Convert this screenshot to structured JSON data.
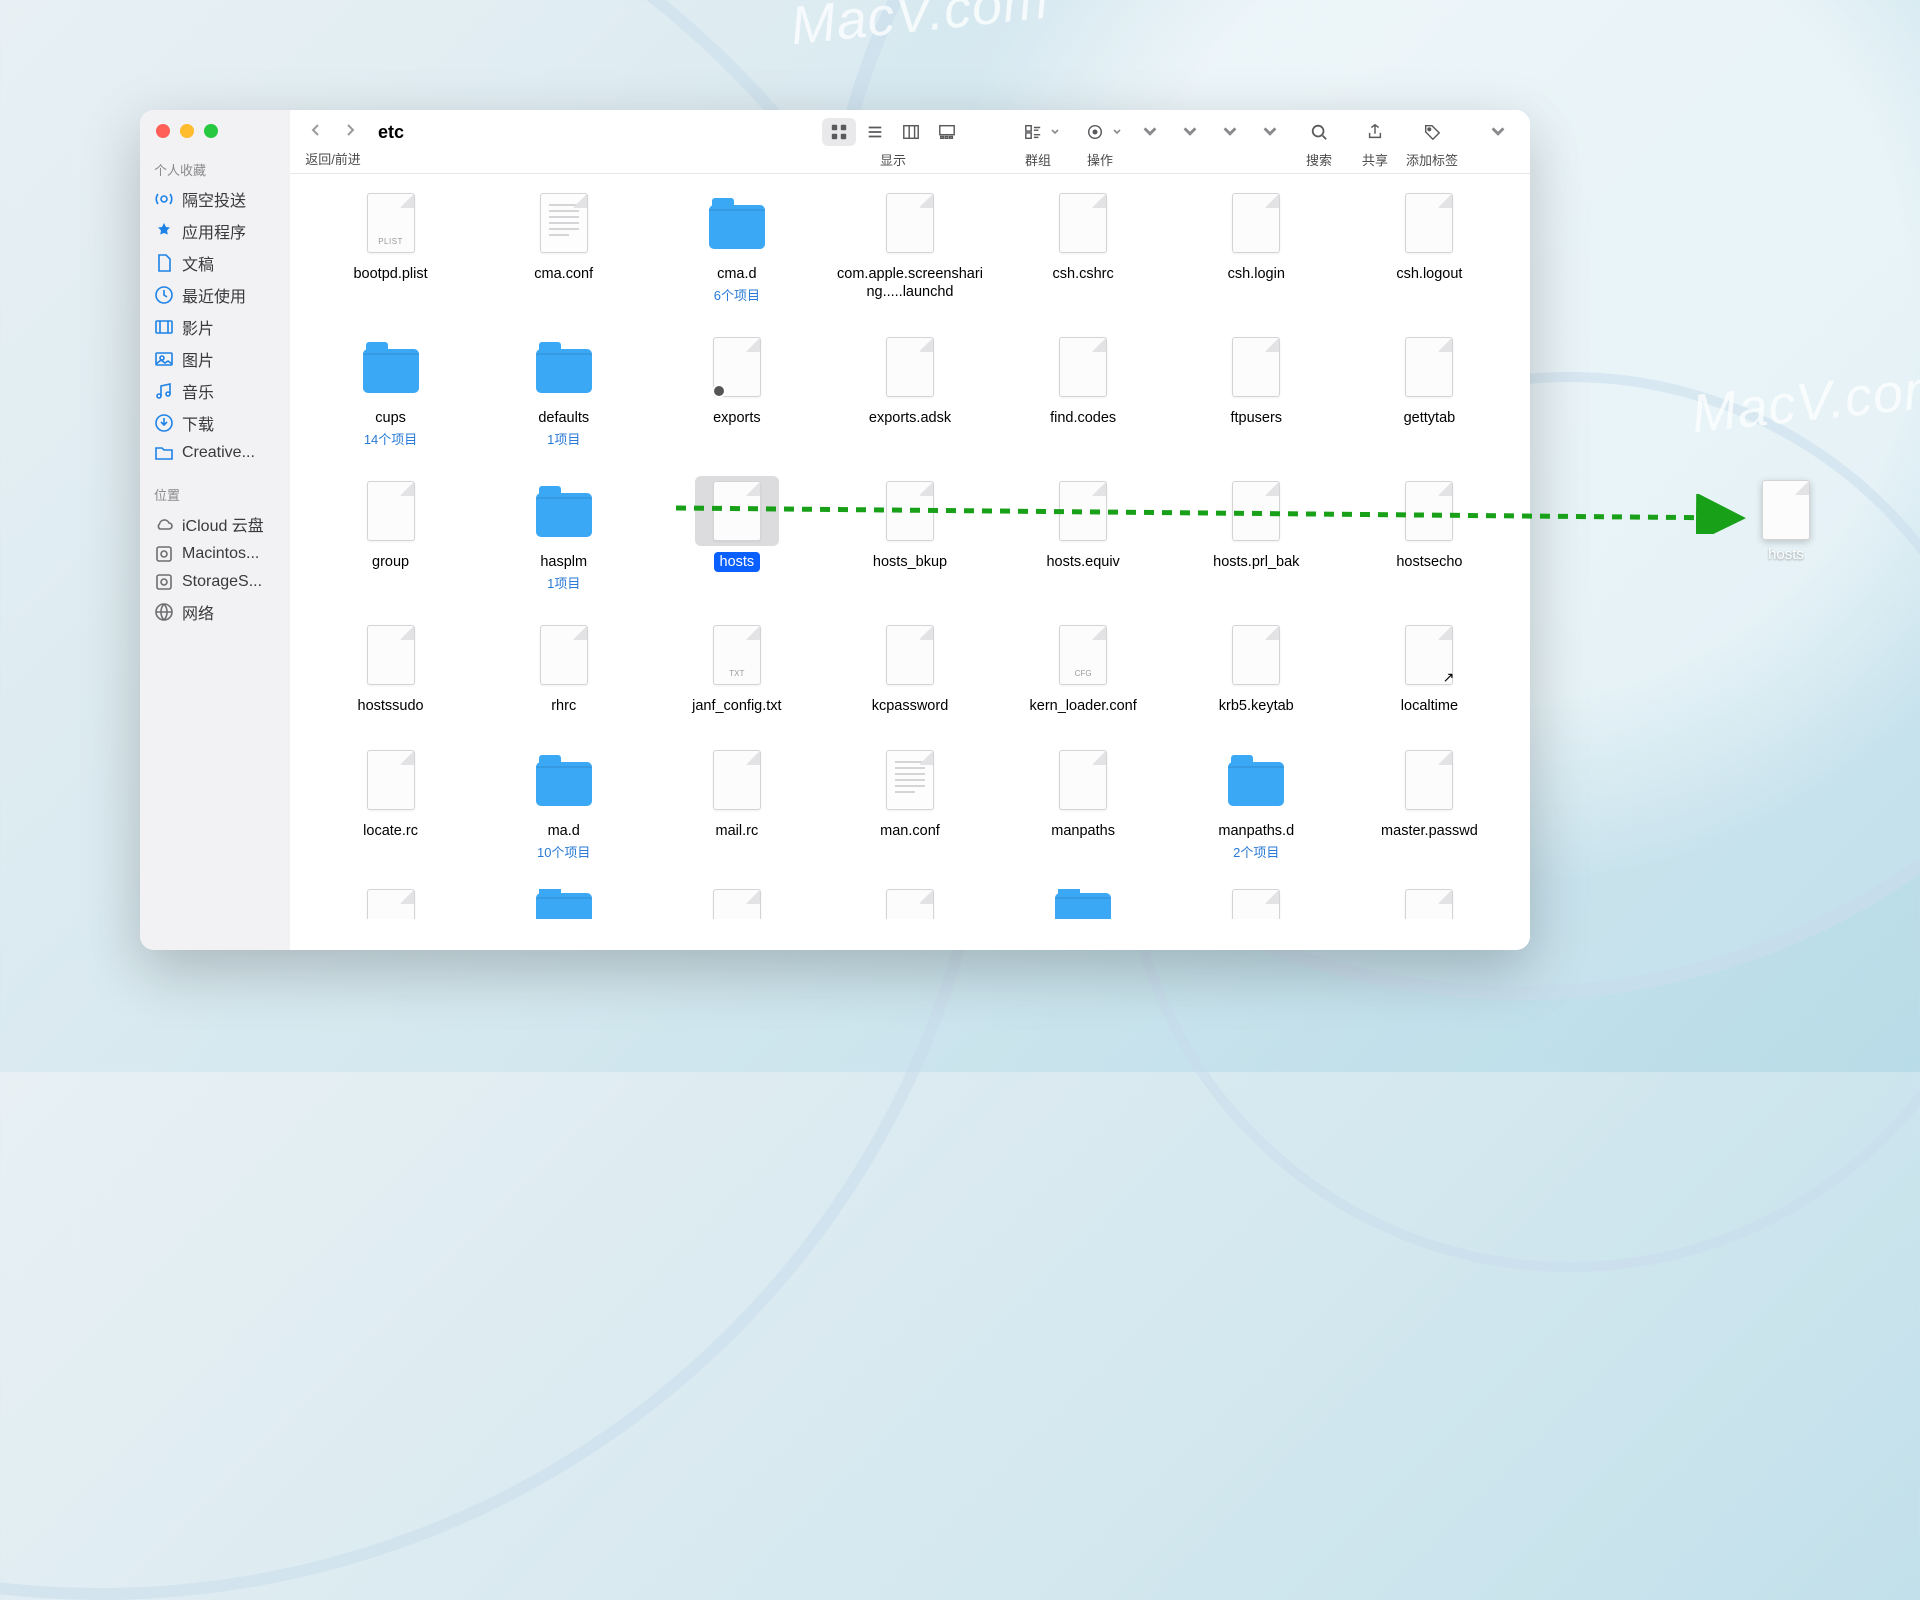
{
  "watermarks": {
    "text": "MacV.com"
  },
  "window": {
    "title": "etc",
    "nav_label": "返回/前进",
    "toolbar": {
      "view_label": "显示",
      "group_label": "群组",
      "action_label": "操作",
      "search_label": "搜索",
      "share_label": "共享",
      "tags_label": "添加标签"
    }
  },
  "sidebar": {
    "favorites_title": "个人收藏",
    "favorites": [
      {
        "icon": "airdrop",
        "label": "隔空投送"
      },
      {
        "icon": "apps",
        "label": "应用程序"
      },
      {
        "icon": "doc",
        "label": "文稿"
      },
      {
        "icon": "clock",
        "label": "最近使用"
      },
      {
        "icon": "movie",
        "label": "影片"
      },
      {
        "icon": "photo",
        "label": "图片"
      },
      {
        "icon": "music",
        "label": "音乐"
      },
      {
        "icon": "download",
        "label": "下载"
      },
      {
        "icon": "folder",
        "label": "Creative..."
      }
    ],
    "locations_title": "位置",
    "locations": [
      {
        "icon": "cloud",
        "label": "iCloud 云盘"
      },
      {
        "icon": "disk",
        "label": "Macintos..."
      },
      {
        "icon": "disk",
        "label": "StorageS..."
      },
      {
        "icon": "globe",
        "label": "网络"
      }
    ]
  },
  "files": [
    {
      "name": "bootpd.plist",
      "type": "plist"
    },
    {
      "name": "cma.conf",
      "type": "lines"
    },
    {
      "name": "cma.d",
      "type": "folder",
      "sub": "6个项目"
    },
    {
      "name": "com.apple.screensharing.....launchd",
      "type": "doc"
    },
    {
      "name": "csh.cshrc",
      "type": "doc"
    },
    {
      "name": "csh.login",
      "type": "doc"
    },
    {
      "name": "csh.logout",
      "type": "doc"
    },
    {
      "name": "cups",
      "type": "folder",
      "sub": "14个项目"
    },
    {
      "name": "defaults",
      "type": "folder",
      "sub": "1项目"
    },
    {
      "name": "exports",
      "type": "doc",
      "lock": true
    },
    {
      "name": "exports.adsk",
      "type": "doc"
    },
    {
      "name": "find.codes",
      "type": "doc"
    },
    {
      "name": "ftpusers",
      "type": "doc"
    },
    {
      "name": "gettytab",
      "type": "doc"
    },
    {
      "name": "group",
      "type": "doc"
    },
    {
      "name": "hasplm",
      "type": "folder",
      "sub": "1项目"
    },
    {
      "name": "hosts",
      "type": "doc",
      "selected": true
    },
    {
      "name": "hosts_bkup",
      "type": "doc"
    },
    {
      "name": "hosts.equiv",
      "type": "doc"
    },
    {
      "name": "hosts.prl_bak",
      "type": "doc"
    },
    {
      "name": "hostsecho",
      "type": "doc"
    },
    {
      "name": "hostssudo",
      "type": "doc"
    },
    {
      "name": "rhrc",
      "type": "doc"
    },
    {
      "name": "janf_config.txt",
      "type": "txt"
    },
    {
      "name": "kcpassword",
      "type": "doc"
    },
    {
      "name": "kern_loader.conf",
      "type": "cfg"
    },
    {
      "name": "krb5.keytab",
      "type": "doc"
    },
    {
      "name": "localtime",
      "type": "doc",
      "alias": true
    },
    {
      "name": "locate.rc",
      "type": "doc"
    },
    {
      "name": "ma.d",
      "type": "folder",
      "sub": "10个项目"
    },
    {
      "name": "mail.rc",
      "type": "doc"
    },
    {
      "name": "man.conf",
      "type": "cfg-lines"
    },
    {
      "name": "manpaths",
      "type": "doc"
    },
    {
      "name": "manpaths.d",
      "type": "folder",
      "sub": "2个项目"
    },
    {
      "name": "master.passwd",
      "type": "doc"
    },
    {
      "name": "",
      "type": "doc-partial"
    },
    {
      "name": "",
      "type": "folder-partial"
    },
    {
      "name": "",
      "type": "doc-partial"
    },
    {
      "name": "",
      "type": "doc-partial"
    },
    {
      "name": "",
      "type": "folder-partial"
    },
    {
      "name": "",
      "type": "doc-partial"
    },
    {
      "name": "",
      "type": "doc-partial"
    }
  ],
  "desktop_file": {
    "name": "hosts"
  }
}
